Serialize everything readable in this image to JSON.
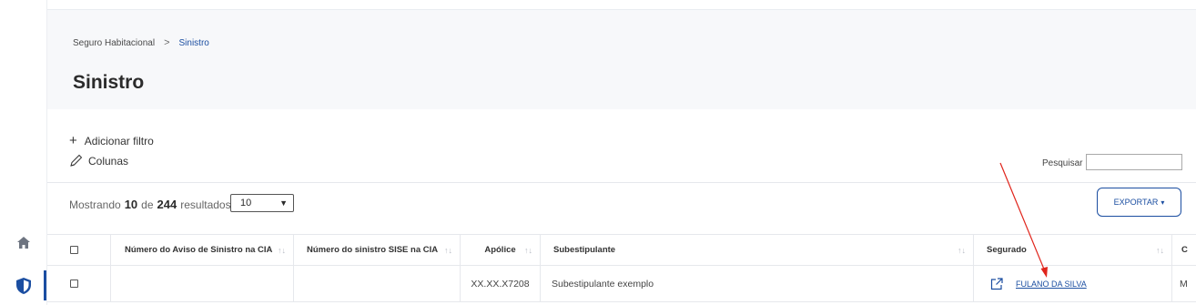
{
  "breadcrumb": {
    "parent": "Seguro Habitacional",
    "separator": ">",
    "current": "Sinistro"
  },
  "page": {
    "title": "Sinistro"
  },
  "toolbar": {
    "add_filter_icon": "+",
    "add_filter_label": "Adicionar filtro",
    "columns_label": "Colunas",
    "search_label": "Pesquisar",
    "search_value": ""
  },
  "results": {
    "prefix": "Mostrando",
    "shown": "10",
    "of_label": "de",
    "total": "244",
    "suffix": "resultados",
    "page_size": "10"
  },
  "export": {
    "label": "EXPORTAR",
    "caret": "▾"
  },
  "table": {
    "headers": [
      "Número do Aviso de Sinistro na CIA",
      "Número do sinistro SISE na CIA",
      "Apólice",
      "Subestipulante",
      "Segurado",
      "C"
    ],
    "sort_glyph": "↑↓",
    "rows": [
      {
        "aviso": "",
        "sise": "",
        "apolice": "XX.XX.X7208",
        "subestipulante": "Subestipulante exemplo",
        "segurado": "FULANO DA SILVA",
        "extra": "M"
      }
    ]
  },
  "colors": {
    "accent": "#1b4ea1",
    "annotation_arrow": "#e0241b",
    "header_band": "#f7f8fa"
  },
  "icons": {
    "home": "home-icon",
    "shield": "shield-icon",
    "edit": "pencil-icon",
    "external": "external-link-icon"
  }
}
